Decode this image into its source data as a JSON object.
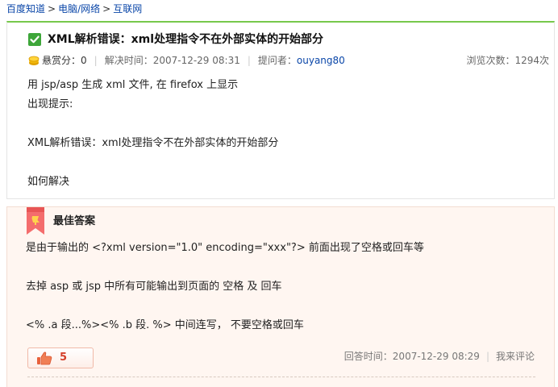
{
  "breadcrumb": {
    "items": [
      "百度知道",
      "电脑/网络",
      "互联网"
    ],
    "separator": ">"
  },
  "question": {
    "title": "XML解析错误：xml处理指令不在外部实体的开始部分",
    "bounty_label": "悬赏分：",
    "bounty_value": "0",
    "solved_time": "解决时间：2007-12-29 08:31",
    "asker_label": "提问者：",
    "asker_name": "ouyang80",
    "views": "浏览次数：1294次",
    "body_lines": [
      "用 jsp/asp 生成 xml 文件, 在 firefox 上显示",
      "出现提示:",
      "",
      "XML解析错误：xml处理指令不在外部实体的开始部分",
      "",
      "如何解决"
    ]
  },
  "answer": {
    "title": "最佳答案",
    "body_lines": [
      "是由于输出的 <?xml version=\"1.0\" encoding=\"xxx\"?>  前面出现了空格或回车等",
      "",
      "去掉 asp 或 jsp 中所有可能输出到页面的 空格 及 回车",
      "",
      "<% .a 段...%><% .b 段. %> 中间连写， 不要空格或回车"
    ],
    "like_count": "5",
    "answer_time": "回答时间：2007-12-29 08:29",
    "comment_link": "我来评论"
  },
  "colors": {
    "link": "#0a46a8",
    "accent_green": "#77c84c",
    "answer_bg": "#fff6f1",
    "like_red": "#d43f2a"
  },
  "icons": {
    "title_check": "check-icon",
    "bounty": "coin-icon",
    "answer_badge": "ribbon-icon",
    "like": "thumbs-up-icon"
  }
}
